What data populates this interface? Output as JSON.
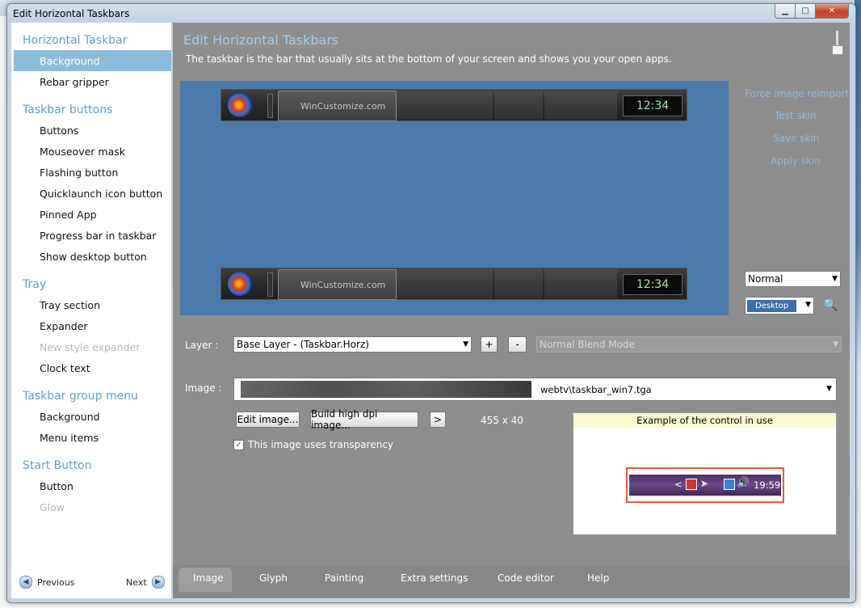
{
  "window": {
    "title": "Edit Horizontal Taskbars"
  },
  "sidebar": {
    "sections": [
      {
        "label": "Horizontal Taskbar",
        "items": [
          "Background",
          "Rebar gripper"
        ]
      },
      {
        "label": "Taskbar buttons",
        "items": [
          "Buttons",
          "Mouseover mask",
          "Flashing button",
          "Quicklaunch icon button",
          "Pinned App",
          "Progress bar in taskbar",
          "Show desktop button"
        ]
      },
      {
        "label": "Tray",
        "items": [
          "Tray section",
          "Expander",
          "New style expander",
          "Clock text"
        ]
      },
      {
        "label": "Taskbar group menu",
        "items": [
          "Background",
          "Menu items"
        ]
      },
      {
        "label": "Start Button",
        "items": [
          "Button",
          "Glow"
        ]
      }
    ],
    "previous": "Previous",
    "next": "Next"
  },
  "main": {
    "title": "Edit Horizontal Taskbars",
    "description": "The taskbar is the bar that usually sits at the bottom of your screen and shows you your open apps.",
    "preview": {
      "app_label": "WinCustomize.com",
      "clock": "12:34"
    },
    "links": [
      "Force image reimport",
      "Test skin",
      "Save skin",
      "Apply skin"
    ],
    "state_select": "Normal",
    "desktop_select": "Desktop",
    "layer_label": "Layer :",
    "layer_value": "Base Layer - (Taskbar.Horz)",
    "add_btn": "+",
    "remove_btn": "-",
    "blend_mode": "Normal Blend Mode",
    "image_label": "Image :",
    "image_path": "webtv\\taskbar_win7.tga",
    "edit_image": "Edit image...",
    "build_hdpi": "Build high dpi image...",
    "more_btn": ">",
    "dimensions": "455 x 40",
    "transparency_label": "This image uses transparency",
    "transparency_checked": true,
    "example": {
      "header": "Example of the control in use",
      "chevron": "<",
      "time": "19:59"
    }
  },
  "tabs": [
    "Image",
    "Glyph",
    "Painting",
    "Extra settings",
    "Code editor",
    "Help"
  ]
}
